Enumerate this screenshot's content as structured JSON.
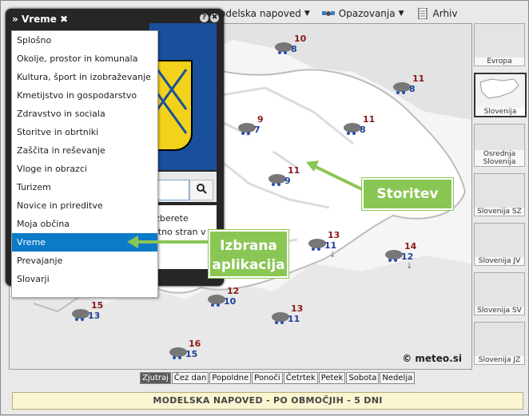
{
  "app_title": "Vreme",
  "app_close_glyph": "✖",
  "panel_buttons": [
    "?",
    "✖"
  ],
  "toolbar": {
    "items": [
      {
        "label": "odelska napoved",
        "icon": "chart-icon",
        "has_dropdown": true
      },
      {
        "label": "Opazovanja",
        "icon": "satellite-icon",
        "has_dropdown": true
      },
      {
        "label": "Arhiv",
        "icon": "document-icon",
        "has_dropdown": false
      }
    ]
  },
  "menu": {
    "items": [
      "Splošno",
      "Okolje, prostor in komunala",
      "Kultura, šport in izobraževanje",
      "Kmetijstvo in gospodarstvo",
      "Zdravstvo in sociala",
      "Storitve in obrtniki",
      "Zaščita in reševanje",
      "Vloge in obrazci",
      "Turizem",
      "Novice in prireditve",
      "Moja občina",
      "Vreme",
      "Prevajanje",
      "Slovarji"
    ],
    "selected": "Vreme"
  },
  "panel_text": [
    "izberete",
    "etno stran v"
  ],
  "stations": [
    {
      "max": "10",
      "min": "8",
      "wind": ""
    },
    {
      "max": "11",
      "min": "8",
      "wind": ""
    },
    {
      "max": "9",
      "min": "7",
      "wind": ""
    },
    {
      "max": "11",
      "min": "8",
      "wind": ""
    },
    {
      "max": "11",
      "min": "9",
      "wind": ""
    },
    {
      "max": "13",
      "min": "11",
      "wind": "↓"
    },
    {
      "max": "14",
      "min": "12",
      "wind": "↓"
    },
    {
      "max": "12",
      "min": "10",
      "wind": ""
    },
    {
      "max": "13",
      "min": "11",
      "wind": ""
    },
    {
      "max": "15",
      "min": "13",
      "wind": ""
    },
    {
      "max": "16",
      "min": "15",
      "wind": ""
    }
  ],
  "copyright": "© meteo.si",
  "thumbnails": [
    "Evropa",
    "Slovenija",
    "Osrednja Slovenija",
    "Slovenija SZ",
    "Slovenija JV",
    "Slovenija SV",
    "Slovenija JZ"
  ],
  "active_thumbnail": "Slovenija",
  "days": [
    "Zjutraj",
    "Čez dan",
    "Popoldne",
    "Ponoči",
    "Četrtek",
    "Petek",
    "Sobota",
    "Nedelja"
  ],
  "active_day": "Zjutraj",
  "footer": "MODELSKA NAPOVED - PO OBMOČJIH - 5 DNI",
  "callouts": {
    "storitev": "Storitev",
    "izbrana_line1": "Izbrana",
    "izbrana_line2": "aplikacija"
  },
  "colors": {
    "accent_green": "#8ac654",
    "selected_blue": "#0d7ac8",
    "panel_dark": "#262626",
    "tmax": "#8b1a1a",
    "tmin": "#1f3f99"
  }
}
